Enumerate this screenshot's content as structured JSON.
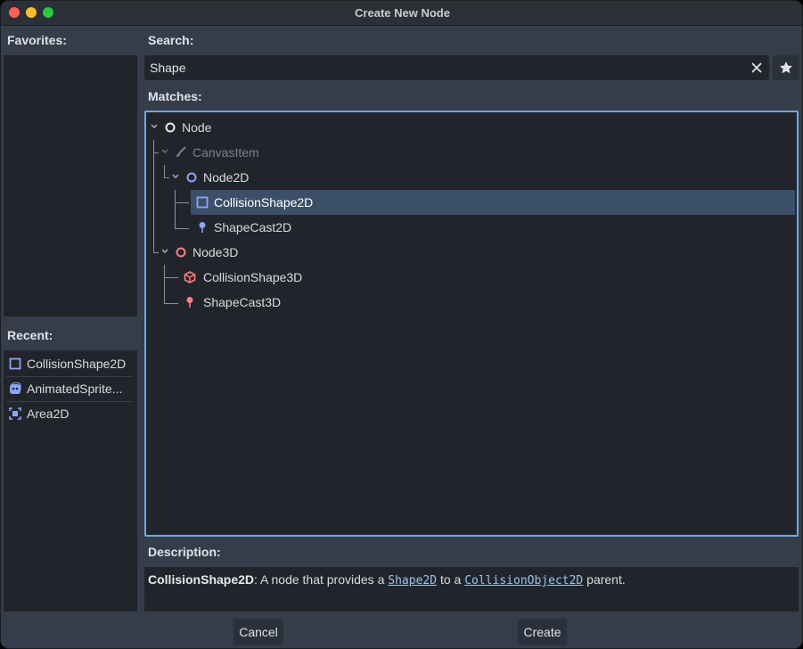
{
  "window": {
    "title": "Create New Node"
  },
  "favorites": {
    "label": "Favorites:"
  },
  "recent": {
    "label": "Recent:",
    "items": [
      {
        "label": "CollisionShape2D",
        "icon": "collision-shape-2d-icon"
      },
      {
        "label": "AnimatedSprite...",
        "icon": "animated-sprite-icon"
      },
      {
        "label": "Area2D",
        "icon": "area-2d-icon"
      }
    ]
  },
  "search": {
    "label": "Search:",
    "value": "Shape"
  },
  "matches": {
    "label": "Matches:",
    "nodes": [
      {
        "label": "Node",
        "icon": "node-circle-icon"
      },
      {
        "label": "CanvasItem",
        "icon": "canvas-item-brush-icon"
      },
      {
        "label": "Node2D",
        "icon": "node2d-circle-icon"
      },
      {
        "label": "CollisionShape2D",
        "icon": "collision-shape-2d-icon"
      },
      {
        "label": "ShapeCast2D",
        "icon": "shape-cast-2d-icon"
      },
      {
        "label": "Node3D",
        "icon": "node3d-circle-icon"
      },
      {
        "label": "CollisionShape3D",
        "icon": "collision-shape-3d-icon"
      },
      {
        "label": "ShapeCast3D",
        "icon": "shape-cast-3d-icon"
      }
    ]
  },
  "description": {
    "label": "Description:",
    "node_name": "CollisionShape2D",
    "part1": ": A node that provides a ",
    "link1": "Shape2D",
    "part2": " to a ",
    "link2": "CollisionObject2D",
    "part3": " parent."
  },
  "buttons": {
    "cancel": "Cancel",
    "create": "Create"
  },
  "colors": {
    "accent": "#6ba9e8",
    "node2d": "#8da5f3",
    "node3d": "#fc7f7f",
    "selection": "#3c4f68"
  }
}
